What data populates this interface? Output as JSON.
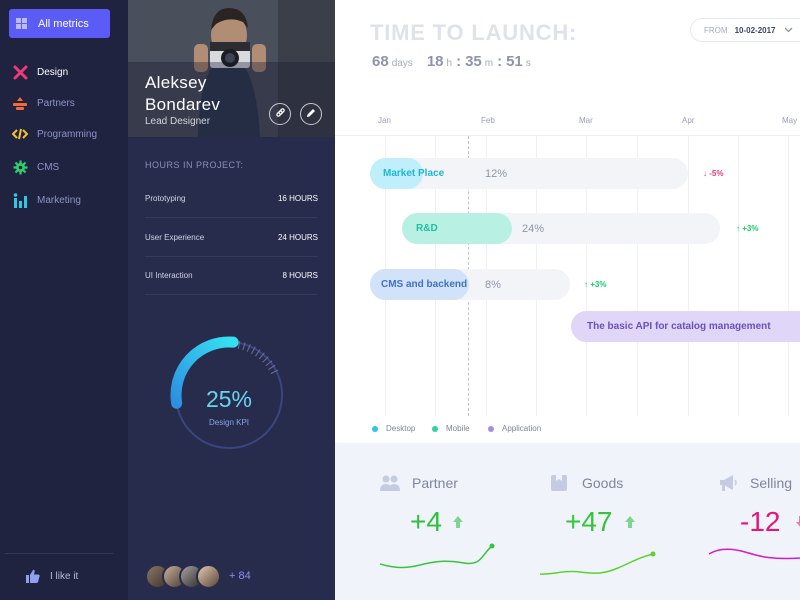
{
  "sidebar": {
    "all_metrics_label": "All metrics",
    "items": [
      {
        "label": "Design",
        "icon": "design-tools-icon",
        "color": "#f0397a",
        "active": true
      },
      {
        "label": "Partners",
        "icon": "partners-icon",
        "color": "#f36b3a",
        "active": false
      },
      {
        "label": "Programming",
        "icon": "code-icon",
        "color": "#f6c332",
        "active": false
      },
      {
        "label": "CMS",
        "icon": "gear-icon",
        "color": "#2ed06f",
        "active": false
      },
      {
        "label": "Marketing",
        "icon": "chart-icon",
        "color": "#2ec8e6",
        "active": false
      }
    ],
    "like_label": "I like it"
  },
  "profile": {
    "name_line1": "Aleksey",
    "name_line2": "Bondarev",
    "role": "Lead Designer",
    "hours_title": "HOURS IN PROJECT:",
    "hours": [
      {
        "label": "Prototyping",
        "value": "16 HOURS"
      },
      {
        "label": "User Experience",
        "value": "24 HOURS"
      },
      {
        "label": "UI Interaction",
        "value": "8 HOURS"
      }
    ],
    "kpi": {
      "value": "25%",
      "label": "Design KPI",
      "fraction": 0.25
    },
    "team_more": "+ 84"
  },
  "header": {
    "title": "TIME TO LAUNCH:",
    "countdown": {
      "days": "68",
      "days_unit": "days",
      "hours": "18",
      "hours_unit": "h",
      "minutes": "35",
      "minutes_unit": "m",
      "seconds": "51",
      "seconds_unit": "s"
    },
    "from_label": "FROM",
    "from_date": "10-02-2017"
  },
  "gantt": {
    "months": [
      "Jan",
      "Feb",
      "Mar",
      "Apr",
      "May"
    ],
    "bars": [
      {
        "label": "Market Place",
        "percent": "12%",
        "delta": "-5%",
        "direction": "down",
        "label_color": "#1fb5d6",
        "fill_color": "#bfeffb"
      },
      {
        "label": "R&D",
        "percent": "24%",
        "delta": "+3%",
        "direction": "up",
        "label_color": "#21bfa0",
        "fill_color": "#b8f1e4"
      },
      {
        "label": "CMS and backend",
        "percent": "8%",
        "delta": "+3%",
        "direction": "up",
        "label_color": "#3f72c4",
        "fill_color": "#d2e2f8"
      },
      {
        "label": "The basic API for catalog management",
        "percent": "",
        "delta": "",
        "direction": "",
        "label_color": "#6c4fc0",
        "fill_color": "#e0d6f8"
      }
    ],
    "legend": [
      {
        "label": "Desktop",
        "color": "#27c7ef"
      },
      {
        "label": "Mobile",
        "color": "#2ed3a6"
      },
      {
        "label": "Application",
        "color": "#a889e8"
      }
    ]
  },
  "stats": [
    {
      "title": "Partner",
      "value": "+4",
      "direction": "up",
      "color": "#2ec23b",
      "icon": "people-icon"
    },
    {
      "title": "Goods",
      "value": "+47",
      "direction": "up",
      "color": "#34c63a",
      "icon": "box-icon"
    },
    {
      "title": "Selling",
      "value": "-12",
      "direction": "down",
      "color": "#e5157a",
      "icon": "megaphone-icon"
    }
  ]
}
